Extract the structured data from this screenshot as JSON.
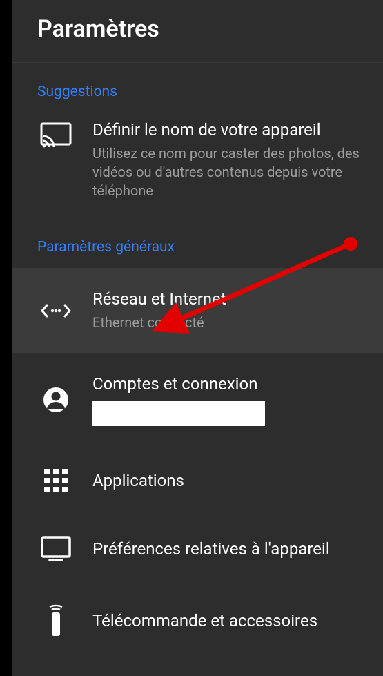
{
  "header": {
    "title": "Paramètres"
  },
  "sections": {
    "suggestions_label": "Suggestions",
    "general_label": "Paramètres généraux"
  },
  "suggestion": {
    "title": "Définir le nom de votre appareil",
    "subtitle": "Utilisez ce nom pour caster des photos, des vidéos ou d'autres contenus depuis votre téléphone"
  },
  "items": {
    "network": {
      "title": "Réseau et Internet",
      "subtitle": "Ethernet connecté"
    },
    "accounts": {
      "title": "Comptes et connexion"
    },
    "apps": {
      "title": "Applications"
    },
    "device": {
      "title": "Préférences relatives à l'appareil"
    },
    "remote": {
      "title": "Télécommande et accessoires"
    }
  },
  "annotation": {
    "color": "#e30000"
  }
}
